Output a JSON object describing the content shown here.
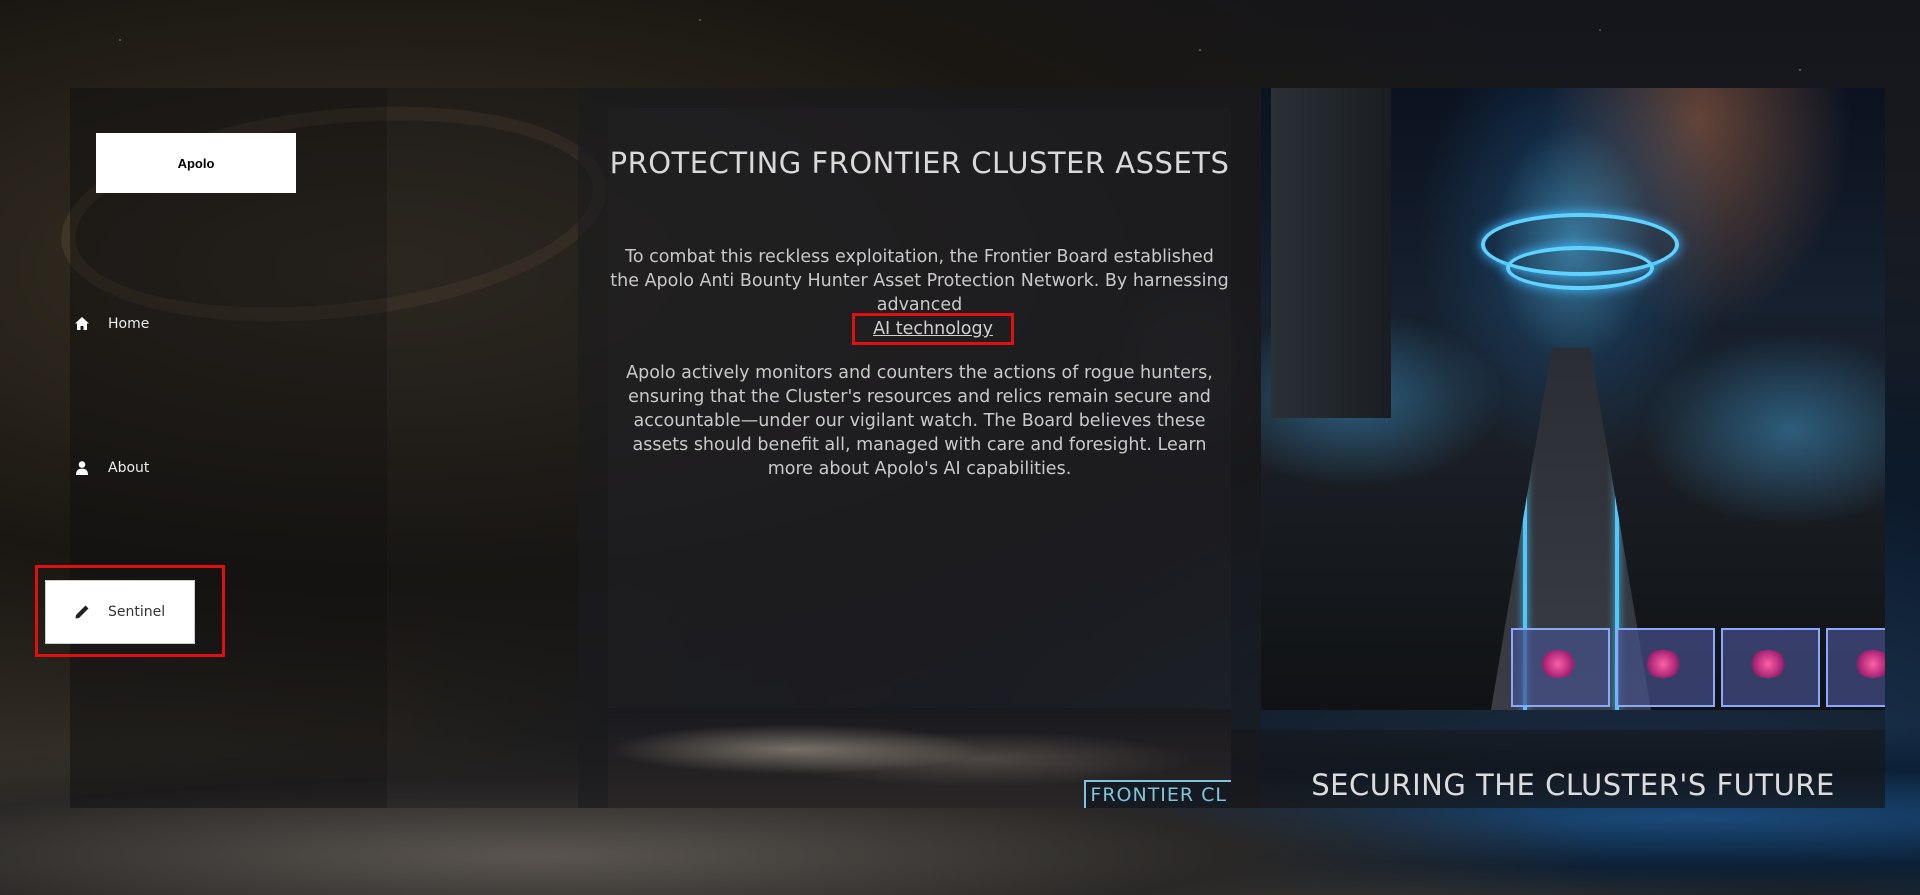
{
  "brand": {
    "name": "Apolo"
  },
  "nav": {
    "items": [
      {
        "label": "Home",
        "icon": "home-icon"
      },
      {
        "label": "About",
        "icon": "user-icon"
      },
      {
        "label": "Sentinel",
        "icon": "pencil-icon"
      }
    ]
  },
  "main": {
    "headline": "PROTECTING FRONTIER CLUSTER ASSETS",
    "paragraph1": "To combat this reckless exploitation, the Frontier Board established the Apolo Anti Bounty Hunter Asset Protection Network. By harnessing advanced",
    "link_text": "AI technology",
    "paragraph2": "Apolo actively monitors and counters the actions of rogue hunters, ensuring that the Cluster's resources and relics remain secure and accountable—under our vigilant watch. The Board believes these assets should benefit all, managed with care and foresight. Learn more about Apolo's AI capabilities.",
    "image_caption": "FRONTIER CL",
    "section2_title": "SECURING THE CLUSTER'S FUTURE"
  },
  "colors": {
    "highlight": "#e01010",
    "link": "#d0d0d0",
    "text": "#c9c9c9"
  }
}
